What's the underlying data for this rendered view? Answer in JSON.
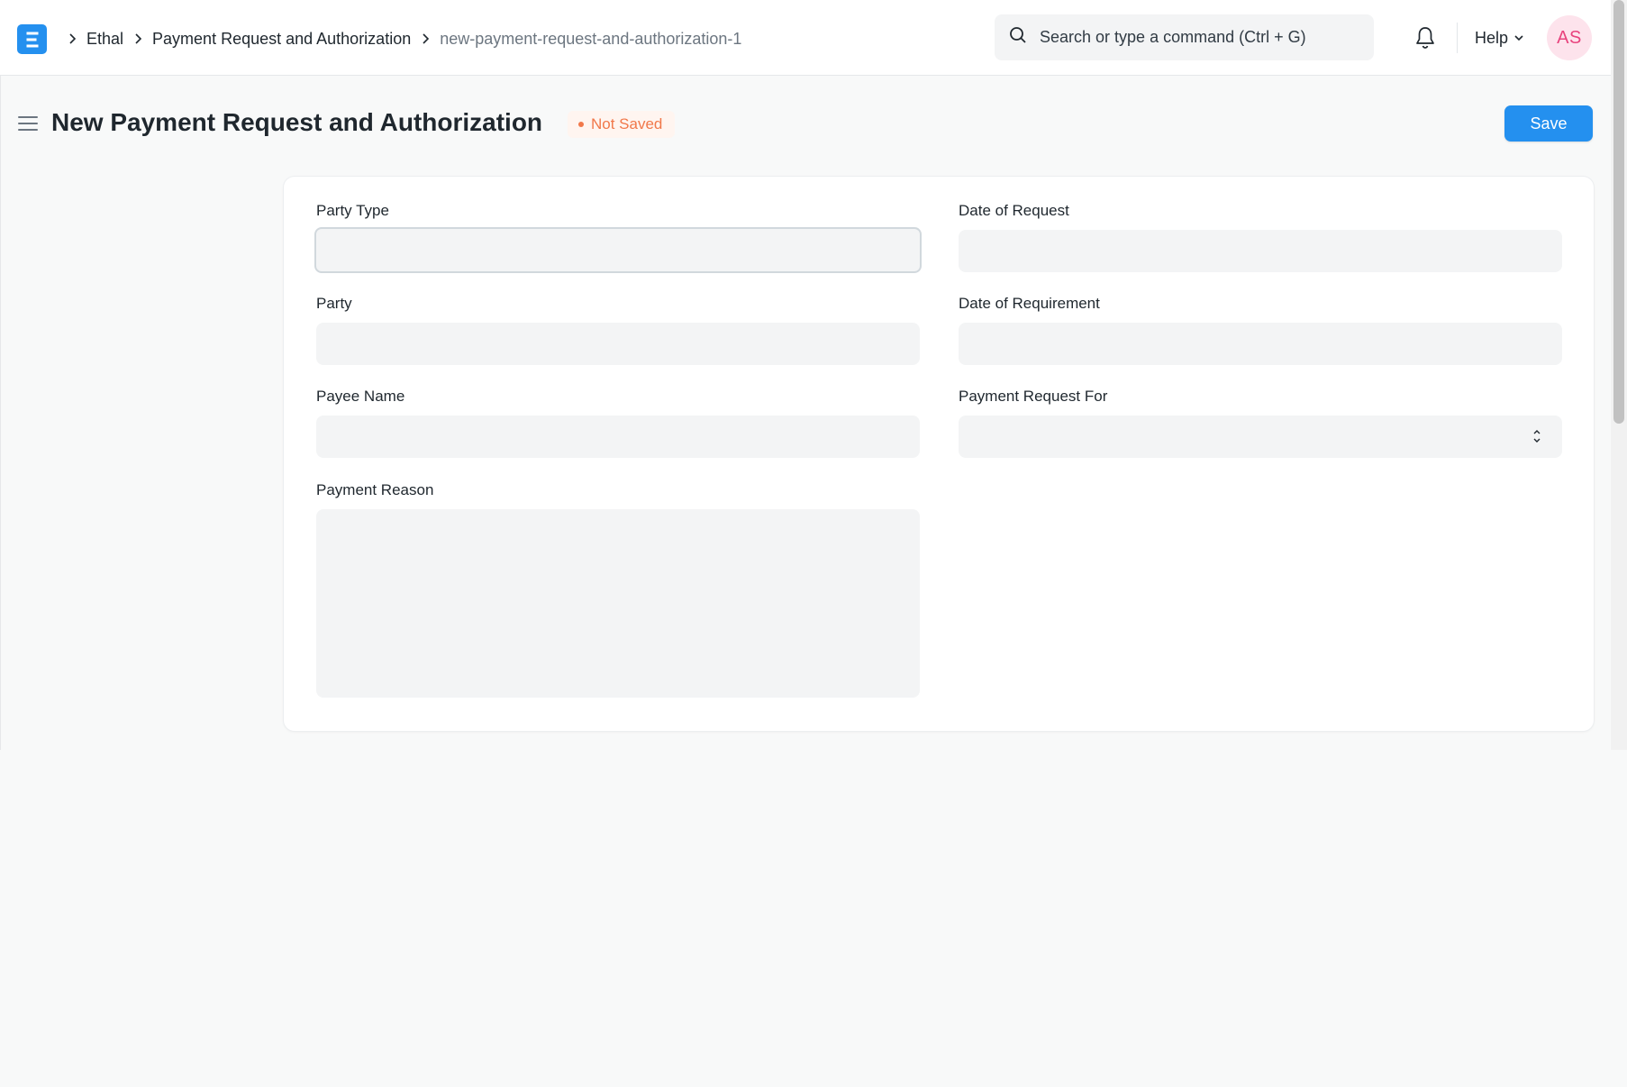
{
  "navbar": {
    "breadcrumbs": [
      {
        "label": "Ethal"
      },
      {
        "label": "Payment Request and Authorization"
      },
      {
        "label": "new-payment-request-and-authorization-1"
      }
    ],
    "search": {
      "placeholder": "Search or type a command (Ctrl + G)",
      "value": ""
    },
    "help_label": "Help",
    "avatar_initials": "AS"
  },
  "page": {
    "title": "New Payment Request and Authorization",
    "status": "Not Saved",
    "save_label": "Save"
  },
  "form": {
    "party_type": {
      "label": "Party Type",
      "value": ""
    },
    "date_of_request": {
      "label": "Date of Request",
      "value": ""
    },
    "party": {
      "label": "Party",
      "value": ""
    },
    "date_of_requirement": {
      "label": "Date of Requirement",
      "value": ""
    },
    "payee_name": {
      "label": "Payee Name",
      "value": ""
    },
    "payment_request_for": {
      "label": "Payment Request For",
      "value": ""
    },
    "payment_reason": {
      "label": "Payment Reason",
      "value": ""
    }
  },
  "colors": {
    "accent": "#2490ef",
    "status": "#f1784a",
    "avatar_bg": "#fde3ec",
    "avatar_fg": "#e8437d"
  },
  "icons": [
    "app-logo-icon",
    "chevron-right-icon",
    "search-icon",
    "bell-icon",
    "chevron-down-icon",
    "hamburger-icon",
    "select-arrows-icon"
  ]
}
